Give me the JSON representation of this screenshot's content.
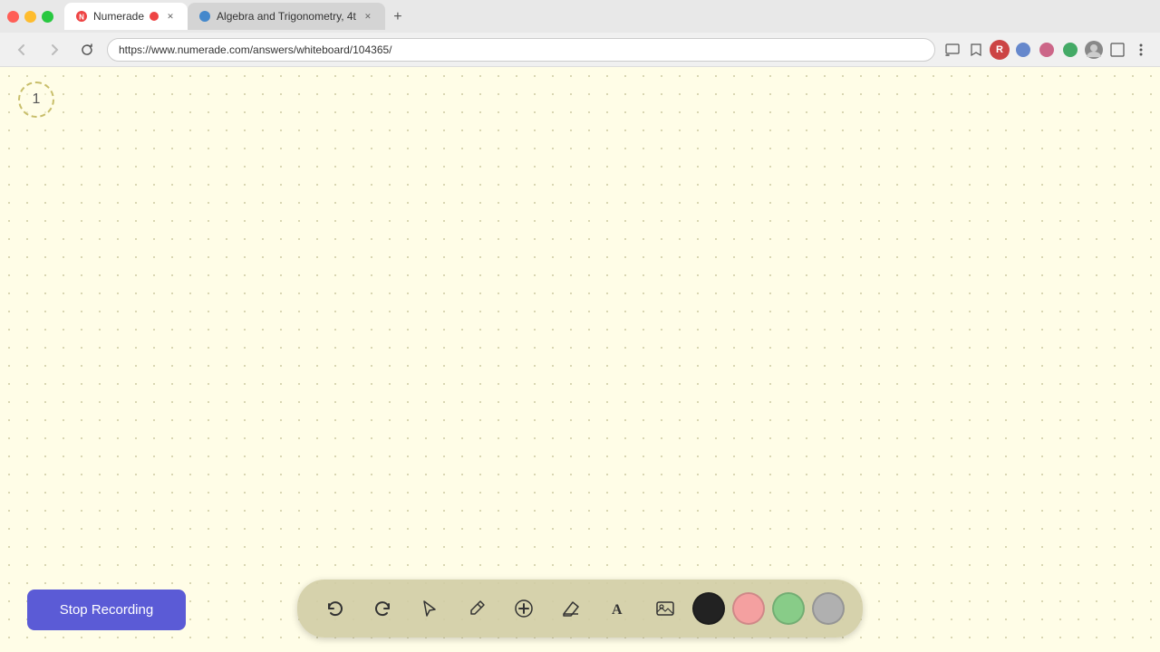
{
  "browser": {
    "tabs": [
      {
        "id": "numerade",
        "label": "Numerade",
        "favicon": "N",
        "active": true,
        "recording": true
      },
      {
        "id": "algebra",
        "label": "Algebra and Trigonometry, 4t",
        "favicon": "🔵",
        "active": false,
        "recording": false
      }
    ],
    "new_tab_label": "+",
    "url": "https://www.numerade.com/answers/whiteboard/104365/",
    "nav": {
      "back": "←",
      "forward": "→",
      "refresh": "↻"
    }
  },
  "whiteboard": {
    "page_number": "1",
    "background_color": "#fffde7"
  },
  "toolbar": {
    "tools": [
      {
        "id": "undo",
        "icon": "↩",
        "label": "undo"
      },
      {
        "id": "redo",
        "icon": "↪",
        "label": "redo"
      },
      {
        "id": "pointer",
        "icon": "▷",
        "label": "pointer"
      },
      {
        "id": "pen",
        "icon": "✏",
        "label": "pen"
      },
      {
        "id": "add",
        "icon": "+",
        "label": "add"
      },
      {
        "id": "eraser",
        "icon": "◫",
        "label": "eraser"
      },
      {
        "id": "text",
        "icon": "A",
        "label": "text"
      },
      {
        "id": "image",
        "icon": "🖼",
        "label": "image"
      }
    ],
    "colors": [
      {
        "id": "black",
        "value": "#222222"
      },
      {
        "id": "pink",
        "value": "#f4a0a0"
      },
      {
        "id": "green",
        "value": "#88cc88"
      },
      {
        "id": "gray",
        "value": "#b0b0b0"
      }
    ]
  },
  "stop_recording_button": {
    "label": "Stop Recording"
  }
}
